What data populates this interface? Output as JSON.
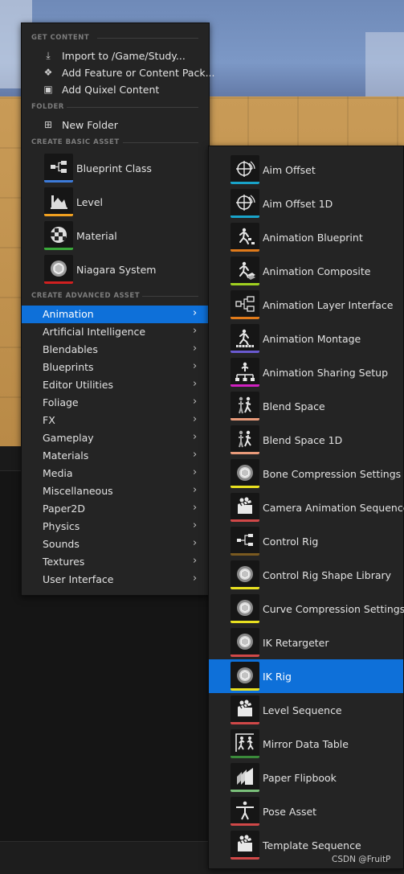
{
  "menu": {
    "sections": {
      "get_content": "GET CONTENT",
      "folder": "FOLDER",
      "create_basic_asset": "CREATE BASIC ASSET",
      "create_advanced_asset": "CREATE ADVANCED ASSET"
    },
    "get_content_items": [
      {
        "label": "Import to /Game/Study...",
        "icon": "import-icon"
      },
      {
        "label": "Add Feature or Content Pack...",
        "icon": "content-pack-icon"
      },
      {
        "label": "Add Quixel Content",
        "icon": "quixel-icon"
      }
    ],
    "folder_items": [
      {
        "label": "New Folder",
        "icon": "new-folder-icon"
      }
    ],
    "basic_assets": [
      {
        "label": "Blueprint Class",
        "icon": "blueprint-class-icon",
        "color": "#3d7bd9"
      },
      {
        "label": "Level",
        "icon": "level-icon",
        "color": "#f0a020"
      },
      {
        "label": "Material",
        "icon": "material-icon",
        "color": "#3aa83a"
      },
      {
        "label": "Niagara System",
        "icon": "niagara-system-icon",
        "color": "#d02020"
      }
    ],
    "advanced_categories": [
      "Animation",
      "Artificial Intelligence",
      "Blendables",
      "Blueprints",
      "Editor Utilities",
      "Foliage",
      "FX",
      "Gameplay",
      "Materials",
      "Media",
      "Miscellaneous",
      "Paper2D",
      "Physics",
      "Sounds",
      "Textures",
      "User Interface"
    ],
    "active_category": "Animation",
    "chevron": "›"
  },
  "submenu": {
    "items": [
      {
        "label": "Aim Offset",
        "icon": "aim-offset-icon",
        "color": "#19a3c9"
      },
      {
        "label": "Aim Offset 1D",
        "icon": "aim-offset-1d-icon",
        "color": "#19a3c9"
      },
      {
        "label": "Animation Blueprint",
        "icon": "animation-blueprint-icon",
        "color": "#e07a1a"
      },
      {
        "label": "Animation Composite",
        "icon": "animation-composite-icon",
        "color": "#a0d020"
      },
      {
        "label": "Animation Layer Interface",
        "icon": "animation-layer-interface-icon",
        "color": "#e07a1a"
      },
      {
        "label": "Animation Montage",
        "icon": "animation-montage-icon",
        "color": "#6a5ad0"
      },
      {
        "label": "Animation Sharing Setup",
        "icon": "animation-sharing-setup-icon",
        "color": "#d020c0"
      },
      {
        "label": "Blend Space",
        "icon": "blend-space-icon",
        "color": "#e89a7a"
      },
      {
        "label": "Blend Space 1D",
        "icon": "blend-space-1d-icon",
        "color": "#e89a7a"
      },
      {
        "label": "Bone Compression Settings",
        "icon": "bone-compression-settings-icon",
        "color": "#e8e020"
      },
      {
        "label": "Camera Animation Sequence",
        "icon": "camera-animation-sequence-icon",
        "color": "#d04848"
      },
      {
        "label": "Control Rig",
        "icon": "control-rig-icon",
        "color": "#7a5a20"
      },
      {
        "label": "Control Rig Shape Library",
        "icon": "control-rig-shape-library-icon",
        "color": "#e8e020"
      },
      {
        "label": "Curve Compression Settings",
        "icon": "curve-compression-settings-icon",
        "color": "#e8e020"
      },
      {
        "label": "IK Retargeter",
        "icon": "ik-retargeter-icon",
        "color": "#d04848"
      },
      {
        "label": "IK Rig",
        "icon": "ik-rig-icon",
        "color": "#e8e020"
      },
      {
        "label": "Level Sequence",
        "icon": "level-sequence-icon",
        "color": "#d04848"
      },
      {
        "label": "Mirror Data Table",
        "icon": "mirror-data-table-icon",
        "color": "#3a8a3a"
      },
      {
        "label": "Paper Flipbook",
        "icon": "paper-flipbook-icon",
        "color": "#7ac07a"
      },
      {
        "label": "Pose Asset",
        "icon": "pose-asset-icon",
        "color": "#d04848"
      },
      {
        "label": "Template Sequence",
        "icon": "template-sequence-icon",
        "color": "#d04848"
      }
    ],
    "active_item": "IK Rig"
  },
  "watermark": "CSDN @FruitP"
}
